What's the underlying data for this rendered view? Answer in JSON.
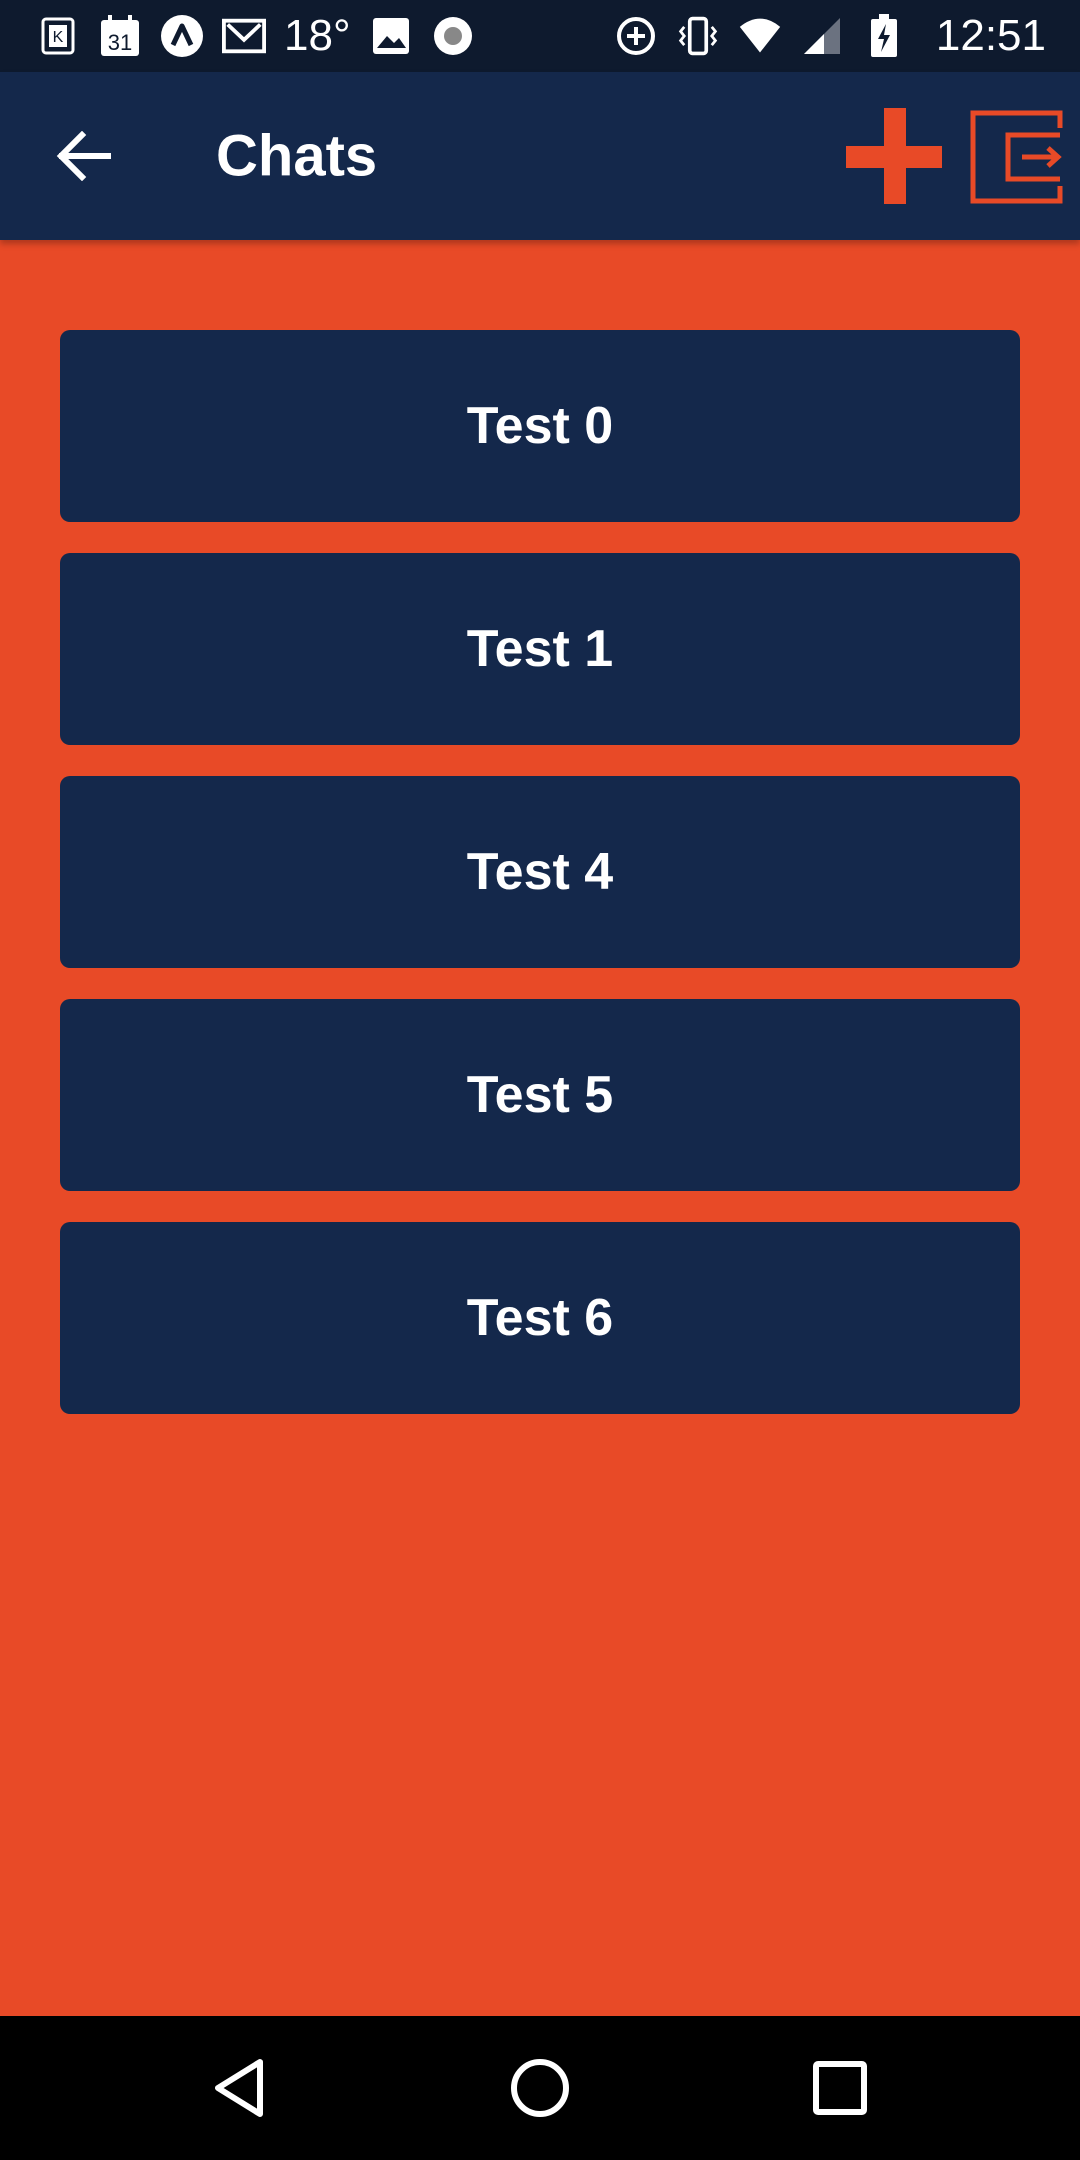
{
  "status_bar": {
    "temperature": "18°",
    "calendar_day": "31",
    "time": "12:51",
    "icons_left": [
      "k-app-icon",
      "calendar-icon",
      "app-logo-icon",
      "gmail-icon",
      "image-icon",
      "record-icon"
    ],
    "icons_right": [
      "data-saver-icon",
      "vibrate-icon",
      "wifi-icon",
      "signal-icon",
      "battery-charging-icon"
    ]
  },
  "app_bar": {
    "title": "Chats",
    "background": "#14284B",
    "accent": "#E84A27"
  },
  "chats": [
    {
      "label": "Test 0"
    },
    {
      "label": "Test 1"
    },
    {
      "label": "Test 4"
    },
    {
      "label": "Test 5"
    },
    {
      "label": "Test 6"
    }
  ],
  "colors": {
    "page_background": "#E84A27",
    "item_background": "#14284B",
    "text": "#FFFFFF"
  }
}
